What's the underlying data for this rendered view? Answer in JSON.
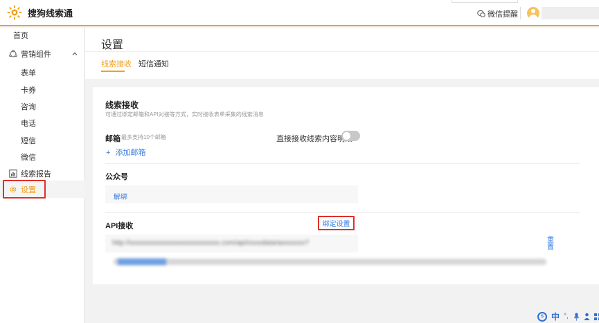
{
  "app": {
    "name": "搜狗线索通"
  },
  "topbar": {
    "wechat_remind": "微信提醒"
  },
  "sidebar": {
    "items": [
      {
        "label": "首页"
      },
      {
        "label": "营销组件",
        "expand_icon": "chevron-up-icon"
      },
      {
        "label": "表单"
      },
      {
        "label": "卡券"
      },
      {
        "label": "咨询"
      },
      {
        "label": "电话"
      },
      {
        "label": "短信"
      },
      {
        "label": "微信"
      },
      {
        "label": "线索报告"
      },
      {
        "label": "设置"
      }
    ]
  },
  "page": {
    "title": "设置",
    "tabs": [
      {
        "label": "线索接收",
        "active": true
      },
      {
        "label": "短信通知",
        "active": false
      }
    ]
  },
  "lead_receive": {
    "title": "线索接收",
    "description": "可通过绑定邮箱和API对接等方式，实时接收表单采集的线索消息",
    "email": {
      "label": "邮箱",
      "hint": "最多支持10个邮箱",
      "add_label": "添加邮箱",
      "direct_label": "直接接收线索内容明细",
      "toggle_on": false
    },
    "official_account": {
      "title": "公众号",
      "unbind_label": "解绑"
    },
    "api": {
      "title": "API接收",
      "bind_settings_label": "绑定设置",
      "url": "http://xxxxxxxxxxxxxxxxxxxxxxxxxx.com/api/xxxxdata/asxxxxxx?",
      "reset_label": "重置",
      "token": "xxxxxxxxxxxxxxxxxxxxxxxxxxxxxxxxxxxxxxxxxxxxxxxxxxxxxxxxxxxxxxxxxxxxxxxxxxxxxxxxxxxxxx"
    }
  },
  "bottom_tools": {
    "lang": "中"
  },
  "colors": {
    "accent": "#f0a020",
    "link": "#3a7de0",
    "highlight_border": "#e0302a"
  }
}
